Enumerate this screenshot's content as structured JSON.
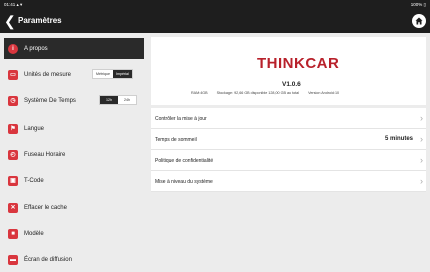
{
  "statusbar": {
    "time": "01:41 ▴ ▾",
    "battery": "100% ▯"
  },
  "header": {
    "title": "Paramètres"
  },
  "sidebar": {
    "items": [
      {
        "label": "A propos",
        "icon": "info-icon"
      },
      {
        "label": "Unités de mesure",
        "icon": "units-icon",
        "options": [
          "Métrique",
          "Impérial"
        ],
        "selected": "Impérial"
      },
      {
        "label": "Système De Temps",
        "icon": "clock-icon",
        "options": [
          "12h",
          "24h"
        ],
        "selected": "12h"
      },
      {
        "label": "Langue",
        "icon": "language-icon"
      },
      {
        "label": "Fuseau Horaire",
        "icon": "timezone-icon"
      },
      {
        "label": "T-Code",
        "icon": "tcode-icon"
      },
      {
        "label": "Effacer le cache",
        "icon": "trash-icon"
      },
      {
        "label": "Modèle",
        "icon": "model-icon"
      },
      {
        "label": "Écran de diffusion",
        "icon": "screen-cast-icon"
      }
    ]
  },
  "about": {
    "brand": "THINKCAR",
    "version": "V1.0.6",
    "ram": "RAM:4GB",
    "storage": "Stockage: 92,66 GB disponible 128,00 GB au total",
    "android": "Version Android:10"
  },
  "settings": {
    "rows": [
      {
        "label": "Contrôler la mise à jour"
      },
      {
        "label": "Temps de sommeil",
        "value": "5 minutes"
      },
      {
        "label": "Politique de confidentialité"
      },
      {
        "label": "Mise à niveau du système"
      }
    ]
  },
  "colors": {
    "accent": "#b8212b",
    "icon_red": "#d9363e",
    "dark": "#1e1e1e"
  }
}
